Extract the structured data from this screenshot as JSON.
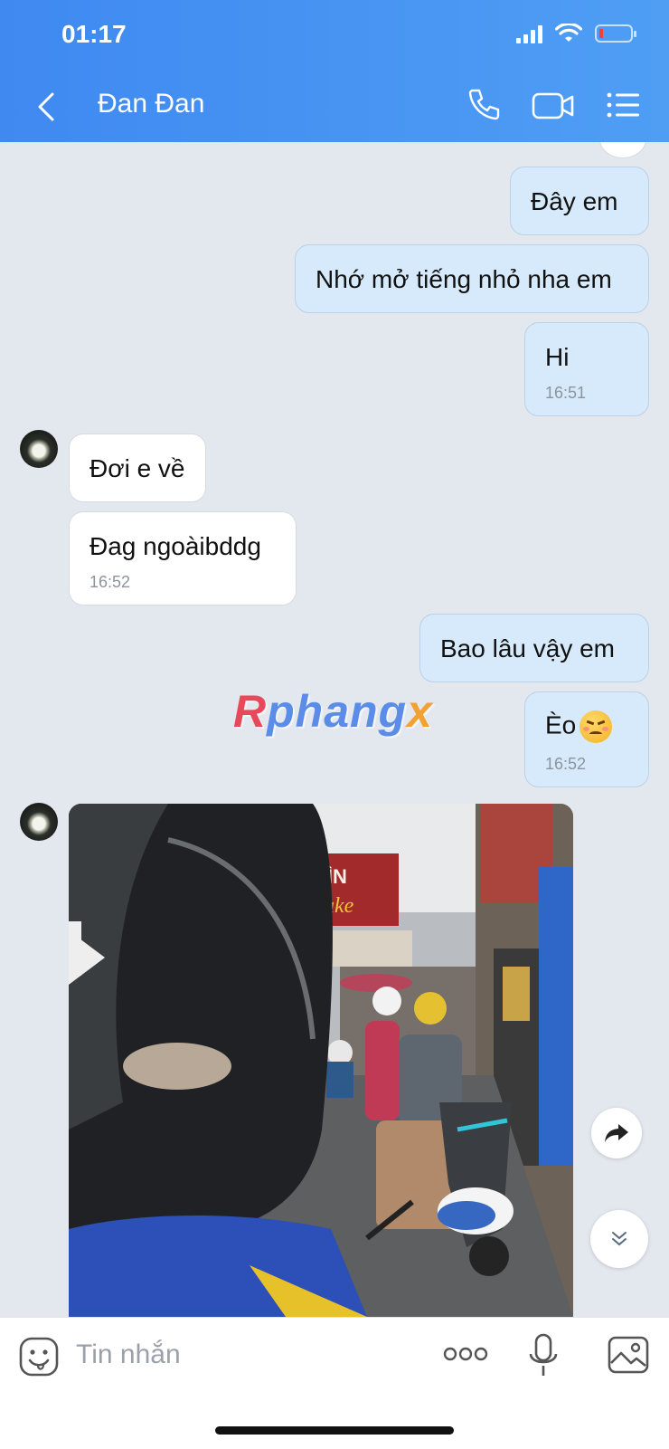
{
  "status_bar": {
    "time": "01:17",
    "battery_level": 0.1
  },
  "nav": {
    "title": "Đan Đan"
  },
  "messages": [
    {
      "side": "out",
      "text": "Đây em",
      "time": ""
    },
    {
      "side": "out",
      "text": "Nhớ mở tiếng nhỏ nha em",
      "time": ""
    },
    {
      "side": "out",
      "text": "Hi",
      "time": "16:51"
    },
    {
      "side": "in",
      "text": "Đơi e về",
      "time": ""
    },
    {
      "side": "in",
      "text": "Đag ngoàibddg",
      "time": "16:52"
    },
    {
      "side": "out",
      "text": "Bao lâu vậy em",
      "time": ""
    },
    {
      "side": "out",
      "text": "Èo",
      "time": "16:52",
      "emoji": "persevering-face"
    },
    {
      "side": "in",
      "type": "image",
      "description": "street-photo-motorbikes"
    }
  ],
  "watermark": {
    "part1": "R",
    "part2": "phang",
    "part3": "x"
  },
  "photo_sign": {
    "line1": "BÌN",
    "line2": "ake"
  },
  "composer": {
    "placeholder": "Tin nhắn"
  },
  "colors": {
    "header": "#4a95f3",
    "outgoing_bubble": "#d6eafb",
    "incoming_bubble": "#ffffff",
    "background": "#e3e7ee"
  }
}
